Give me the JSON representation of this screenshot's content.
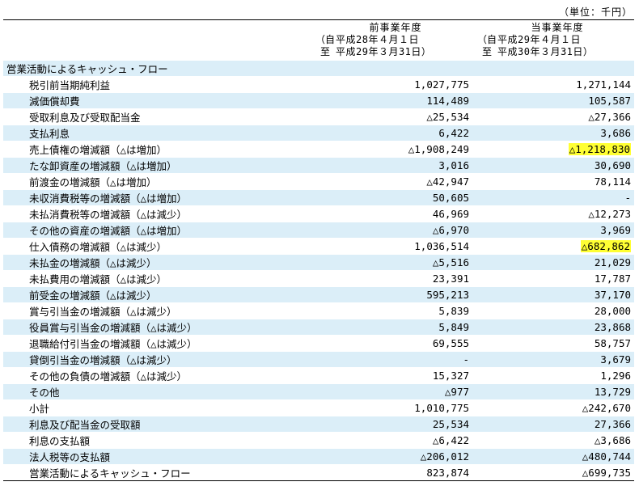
{
  "unit": "（単位：千円）",
  "columns": [
    {
      "title": "前事業年度",
      "from_bracket": "（自",
      "from_date": "平成28年４月１日",
      "to_bracket": "至",
      "to_date": "平成29年３月31日）"
    },
    {
      "title": "当事業年度",
      "from_bracket": "（自",
      "from_date": "平成29年４月１日",
      "to_bracket": "至",
      "to_date": "平成30年３月31日）"
    }
  ],
  "rows": [
    {
      "label": "営業活動によるキャッシュ・フロー",
      "indent": 0,
      "prev": "",
      "curr": "",
      "shade": true
    },
    {
      "label": "税引前当期純利益",
      "indent": 1,
      "prev": "1,027,775",
      "curr": "1,271,144",
      "shade": false
    },
    {
      "label": "減価償却費",
      "indent": 1,
      "prev": "114,489",
      "curr": "105,587",
      "shade": true
    },
    {
      "label": "受取利息及び受取配当金",
      "indent": 1,
      "prev": "△25,534",
      "curr": "△27,366",
      "shade": false
    },
    {
      "label": "支払利息",
      "indent": 1,
      "prev": "6,422",
      "curr": "3,686",
      "shade": true
    },
    {
      "label": "売上債権の増減額（△は増加）",
      "indent": 1,
      "prev": "△1,908,249",
      "curr": "△1,218,830",
      "shade": false,
      "hl": true
    },
    {
      "label": "たな卸資産の増減額（△は増加）",
      "indent": 1,
      "prev": "3,016",
      "curr": "30,690",
      "shade": true
    },
    {
      "label": "前渡金の増減額（△は増加）",
      "indent": 1,
      "prev": "△42,947",
      "curr": "78,114",
      "shade": false
    },
    {
      "label": "未収消費税等の増減額（△は増加）",
      "indent": 1,
      "prev": "50,605",
      "curr": "-",
      "shade": true
    },
    {
      "label": "未払消費税等の増減額（△は減少）",
      "indent": 1,
      "prev": "46,969",
      "curr": "△12,273",
      "shade": false
    },
    {
      "label": "その他の資産の増減額（△は増加）",
      "indent": 1,
      "prev": "△6,970",
      "curr": "3,969",
      "shade": true
    },
    {
      "label": "仕入債務の増減額（△は減少）",
      "indent": 1,
      "prev": "1,036,514",
      "curr": "△682,862",
      "shade": false,
      "hl": true
    },
    {
      "label": "未払金の増減額（△は減少）",
      "indent": 1,
      "prev": "△5,516",
      "curr": "21,029",
      "shade": true
    },
    {
      "label": "未払費用の増減額（△は減少）",
      "indent": 1,
      "prev": "23,391",
      "curr": "17,787",
      "shade": false
    },
    {
      "label": "前受金の増減額（△は減少）",
      "indent": 1,
      "prev": "595,213",
      "curr": "37,170",
      "shade": true
    },
    {
      "label": "賞与引当金の増減額（△は減少）",
      "indent": 1,
      "prev": "5,839",
      "curr": "28,000",
      "shade": false
    },
    {
      "label": "役員賞与引当金の増減額（△は減少）",
      "indent": 1,
      "prev": "5,849",
      "curr": "23,868",
      "shade": true
    },
    {
      "label": "退職給付引当金の増減額（△は減少）",
      "indent": 1,
      "prev": "69,555",
      "curr": "58,757",
      "shade": false
    },
    {
      "label": "貸倒引当金の増減額（△は減少）",
      "indent": 1,
      "prev": "-",
      "curr": "3,679",
      "shade": true
    },
    {
      "label": "その他の負債の増減額（△は減少）",
      "indent": 1,
      "prev": "15,327",
      "curr": "1,296",
      "shade": false
    },
    {
      "label": "その他",
      "indent": 1,
      "prev": "△977",
      "curr": "13,729",
      "shade": true
    },
    {
      "label": "小計",
      "indent": 1,
      "prev": "1,010,775",
      "curr": "△242,670",
      "shade": false
    },
    {
      "label": "利息及び配当金の受取額",
      "indent": 1,
      "prev": "25,534",
      "curr": "27,366",
      "shade": true
    },
    {
      "label": "利息の支払額",
      "indent": 1,
      "prev": "△6,422",
      "curr": "△3,686",
      "shade": false
    },
    {
      "label": "法人税等の支払額",
      "indent": 1,
      "prev": "△206,012",
      "curr": "△480,744",
      "shade": true
    },
    {
      "label": "営業活動によるキャッシュ・フロー",
      "indent": 1,
      "prev": "823,874",
      "curr": "△699,735",
      "shade": false,
      "total": true
    }
  ]
}
